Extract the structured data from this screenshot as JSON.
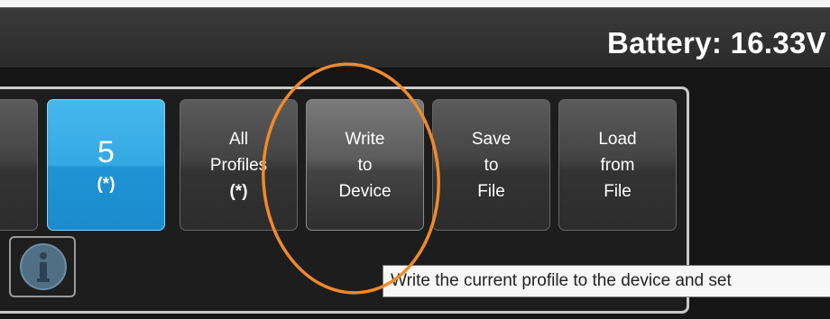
{
  "header": {
    "battery_label": "Battery: 16.33V"
  },
  "tiles": [
    {
      "lines": [
        "5",
        "(*)"
      ],
      "state": "selected"
    },
    {
      "lines": [
        "All",
        "Profiles",
        "(*)"
      ],
      "state": "normal"
    },
    {
      "lines": [
        "Write",
        "to",
        "Device"
      ],
      "state": "hover"
    },
    {
      "lines": [
        "Save",
        "to",
        "File"
      ],
      "state": "normal"
    },
    {
      "lines": [
        "Load",
        "from",
        "File"
      ],
      "state": "normal"
    }
  ],
  "tooltip": {
    "text": "Write the current profile to the device and set"
  },
  "icons": {
    "info": "info-icon"
  },
  "colors": {
    "selected_tile": "#33a8e2",
    "annotation_circle": "#f08a2a",
    "tooltip_bg": "#f7f7f7"
  }
}
